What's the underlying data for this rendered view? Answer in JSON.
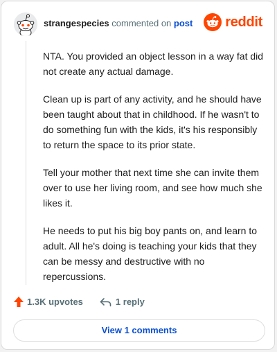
{
  "header": {
    "username": "strangespecies",
    "action_text": "commented on",
    "post_link": "post",
    "logo_text": "reddit"
  },
  "comment": {
    "paragraphs": [
      "NTA. You provided an object lesson in a way fat did not create any actual damage.",
      "Clean up is part of any activity, and he should have been taught about that in childhood. If he wasn't to do something fun with the kids, it's his responsibly to return the space to its prior state.",
      "Tell your mother that next time she can invite them over to use her living room, and see how much she likes it.",
      "He needs to put his big boy pants on, and learn to adult. All he's doing is teaching your kids that they can be messy and destructive with no repercussions."
    ]
  },
  "actions": {
    "upvotes": "1.3K upvotes",
    "replies": "1 reply"
  },
  "footer": {
    "view_comments": "View 1 comments"
  },
  "colors": {
    "brand": "#ff4500",
    "link": "#0a4fd1",
    "muted": "#576f76"
  },
  "icons": [
    "snoo-avatar-icon",
    "reddit-logo-icon",
    "upvote-arrow-icon",
    "reply-arrow-icon"
  ]
}
